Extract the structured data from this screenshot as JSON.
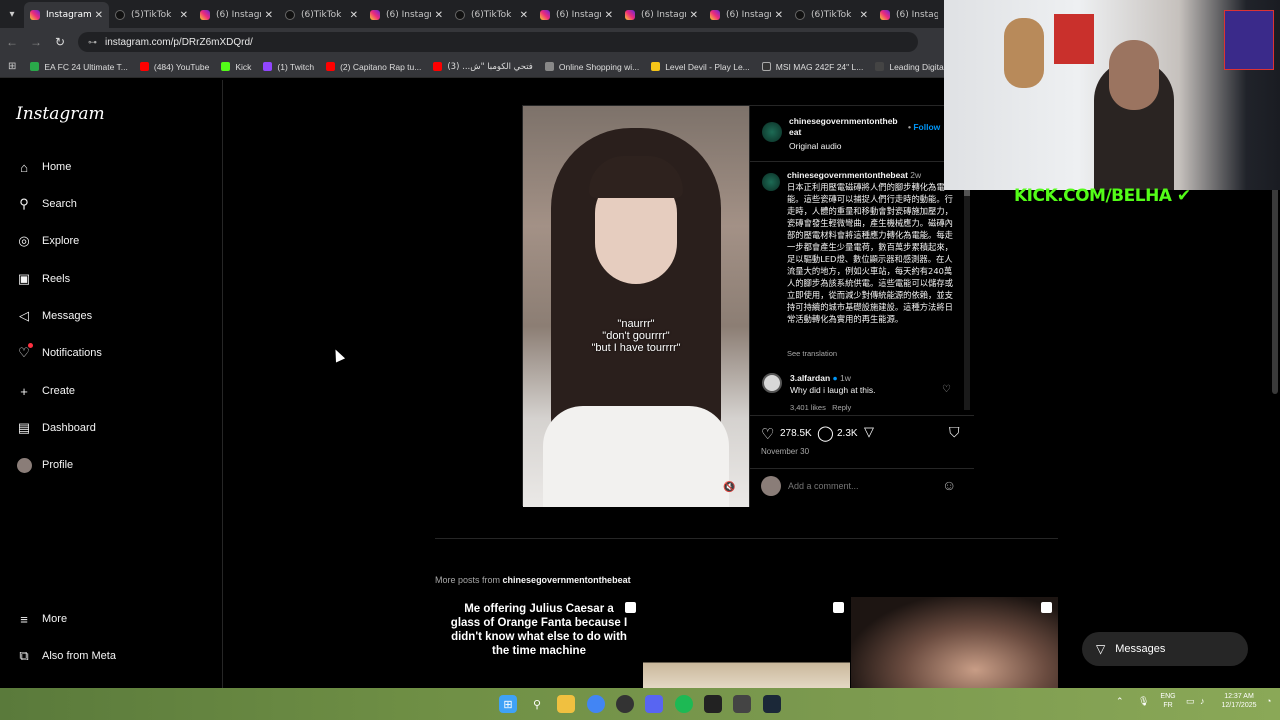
{
  "browser": {
    "tabs": [
      {
        "label": "Instagram",
        "icon": "instagram",
        "active": true
      },
      {
        "label": "(5)TikTok",
        "icon": "tiktok"
      },
      {
        "label": "(6) Instagr",
        "icon": "instagram"
      },
      {
        "label": "(6)TikTok",
        "icon": "tiktok"
      },
      {
        "label": "(6) Instagr",
        "icon": "instagram"
      },
      {
        "label": "(6)TikTok",
        "icon": "tiktok"
      },
      {
        "label": "(6) Instagr",
        "icon": "instagram"
      },
      {
        "label": "(6) Instagr",
        "icon": "instagram"
      },
      {
        "label": "(6) Instagr",
        "icon": "instagram"
      },
      {
        "label": "(6)TikTok",
        "icon": "tiktok"
      },
      {
        "label": "(6) Instagr",
        "icon": "instagram"
      }
    ],
    "url": "instagram.com/p/DRrZ6mXDQrd/",
    "bookmarks": [
      {
        "label": "EA FC 24 Ultimate T...",
        "color": "#2aa84a"
      },
      {
        "label": "(484) YouTube",
        "color": "#ff0000"
      },
      {
        "label": "Kick",
        "color": "#53fc18"
      },
      {
        "label": "(1) Twitch",
        "color": "#9146ff"
      },
      {
        "label": "(2) Capitano Rap tu...",
        "color": "#ff0000"
      },
      {
        "label": "فتحي الكومبا \"ش... (3)",
        "color": "#ff0000"
      },
      {
        "label": "Online Shopping wi...",
        "color": "#888888"
      },
      {
        "label": "Level Devil - Play Le...",
        "color": "#f5c518"
      },
      {
        "label": "MSI MAG 242F 24\" L...",
        "color": "#333333"
      },
      {
        "label": "Leading Digital Stor...",
        "color": "#444444"
      }
    ]
  },
  "sidebar": {
    "logo": "Instagram",
    "items": [
      {
        "label": "Home",
        "icon": "home-icon"
      },
      {
        "label": "Search",
        "icon": "search-icon"
      },
      {
        "label": "Explore",
        "icon": "compass-icon"
      },
      {
        "label": "Reels",
        "icon": "reels-icon"
      },
      {
        "label": "Messages",
        "icon": "messenger-icon"
      },
      {
        "label": "Notifications",
        "icon": "heart-icon"
      },
      {
        "label": "Create",
        "icon": "plus-icon"
      },
      {
        "label": "Dashboard",
        "icon": "dashboard-icon"
      },
      {
        "label": "Profile",
        "icon": "avatar"
      }
    ],
    "bottom": [
      {
        "label": "More",
        "icon": "menu-icon"
      },
      {
        "label": "Also from Meta",
        "icon": "meta-icon"
      }
    ]
  },
  "post": {
    "author": "chinesegovernmentonthebeat",
    "author_line1": "chinesegovernmentontheb",
    "author_line2": "eat",
    "follow": "Follow",
    "audio": "Original audio",
    "video_caption_lines": [
      "\"naurrr\"",
      "\"don't gourrrr\"",
      "\"but I have tourrrr\""
    ],
    "caption_author": "chinesegovernmentonthebeat",
    "caption_time": "2w",
    "caption_text": "日本正利用壓電磁磚將人們的腳步轉化為電能。這些瓷磚可以捕捉人們行走時的動能。行走時，人體的重量和移動會對瓷磚施加壓力，瓷磚會發生輕微彎曲，產生機械應力。磁磚內部的壓電材料會將這種應力轉化為電能。每走一步都會產生少量電荷，數百萬步累積起來，足以驅動LED燈、數位顯示器和感測器。在人流量大的地方，例如火車站，每天約有240萬人的腳步為該系統供電。這些電能可以儲存或立即使用，從而減少對傳統能源的依賴，並支持可持續的城市基礎設施建設。這種方法將日常活動轉化為實用的再生能源。",
    "see_translation": "See translation",
    "comment": {
      "user": "3.alfardan",
      "time": "1w",
      "text": "Why did i laugh at this.",
      "likes": "3,401 likes",
      "reply": "Reply"
    },
    "likes": "278.5K",
    "comments": "2.3K",
    "date": "November 30",
    "add_comment_placeholder": "Add a comment..."
  },
  "more_posts": {
    "prefix": "More posts from",
    "user": "chinesegovernmentonthebeat",
    "thumb1_text": "Me offering Julius Caesar a glass of Orange Fanta because I didn't know what else to do with the time machine"
  },
  "overlay": {
    "kick_text": "KICK.COM/BELHA"
  },
  "messages_pill": "Messages",
  "taskbar": {
    "lang_top": "ENG",
    "lang_bottom": "FR",
    "time": "12:37 AM",
    "date": "12/17/2025"
  }
}
